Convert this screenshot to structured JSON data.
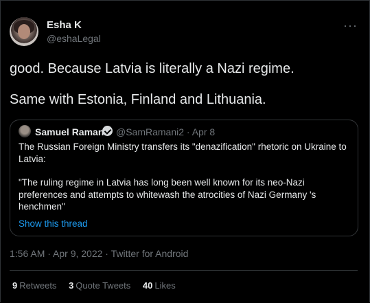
{
  "author": {
    "name": "Esha K",
    "handle": "@eshaLegal"
  },
  "menu_icon": "more-horizontal-icon",
  "tweet_text": {
    "line1": "good. Because Latvia is literally a Nazi regime.",
    "line2": "Same with Estonia, Finland and Lithuania."
  },
  "quoted": {
    "name": "Samuel Ramani",
    "verified_icon": "verified-badge-icon",
    "handle_date": "@SamRamani2 · Apr 8",
    "line1": "The Russian Foreign Ministry transfers its \"denazification\" rhetoric on Ukraine to",
    "line2": "Latvia:",
    "line3": "\"The ruling regime in Latvia has long been well known for its neo-Nazi",
    "line4": "preferences and attempts to whitewash the atrocities of Nazi Germany 's",
    "line5": "henchmen\"",
    "show_thread": "Show this thread"
  },
  "meta": "1:56 AM · Apr 9, 2022 · Twitter for Android",
  "stats": {
    "retweets_count": "9",
    "retweets_label": "Retweets",
    "quotes_count": "3",
    "quotes_label": "Quote Tweets",
    "likes_count": "40",
    "likes_label": "Likes"
  },
  "colors": {
    "background": "#000000",
    "text": "#e7e9ea",
    "secondary": "#71767b",
    "link": "#1d9bf0",
    "border": "#2f3336"
  }
}
